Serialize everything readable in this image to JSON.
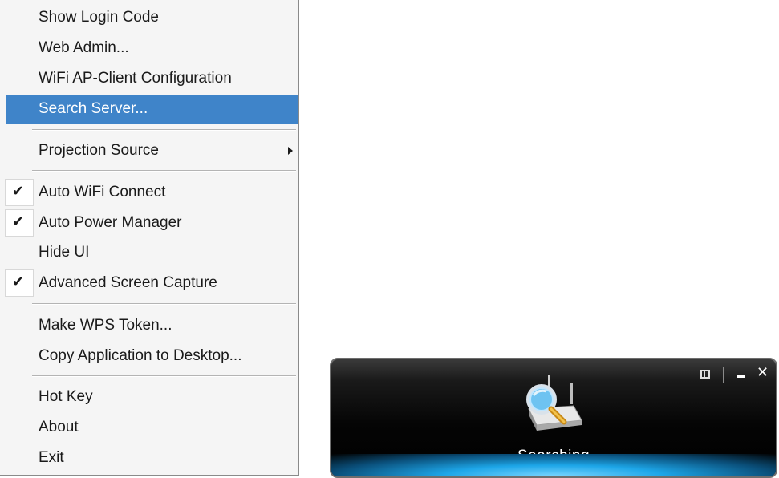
{
  "menu": {
    "items": [
      {
        "label": "Show Login Code"
      },
      {
        "label": "Web Admin..."
      },
      {
        "label": "WiFi AP-Client Configuration"
      },
      {
        "label": "Search Server...",
        "highlighted": true
      },
      {
        "label": "Projection Source",
        "submenu": true
      },
      {
        "label": "Auto WiFi Connect",
        "checked": true
      },
      {
        "label": "Auto Power Manager",
        "checked": true
      },
      {
        "label": "Hide UI",
        "checked": false
      },
      {
        "label": "Advanced Screen Capture",
        "checked": true
      },
      {
        "label": "Make WPS Token..."
      },
      {
        "label": "Copy Application to Desktop..."
      },
      {
        "label": "Hot Key"
      },
      {
        "label": "About"
      },
      {
        "label": "Exit"
      }
    ],
    "check_glyph": "✔",
    "highlight_color": "#3f84c9"
  },
  "widget": {
    "status": "Searching",
    "icon": "router-search-icon",
    "close_glyph": "✕",
    "accent_color": "#1da6e8"
  }
}
